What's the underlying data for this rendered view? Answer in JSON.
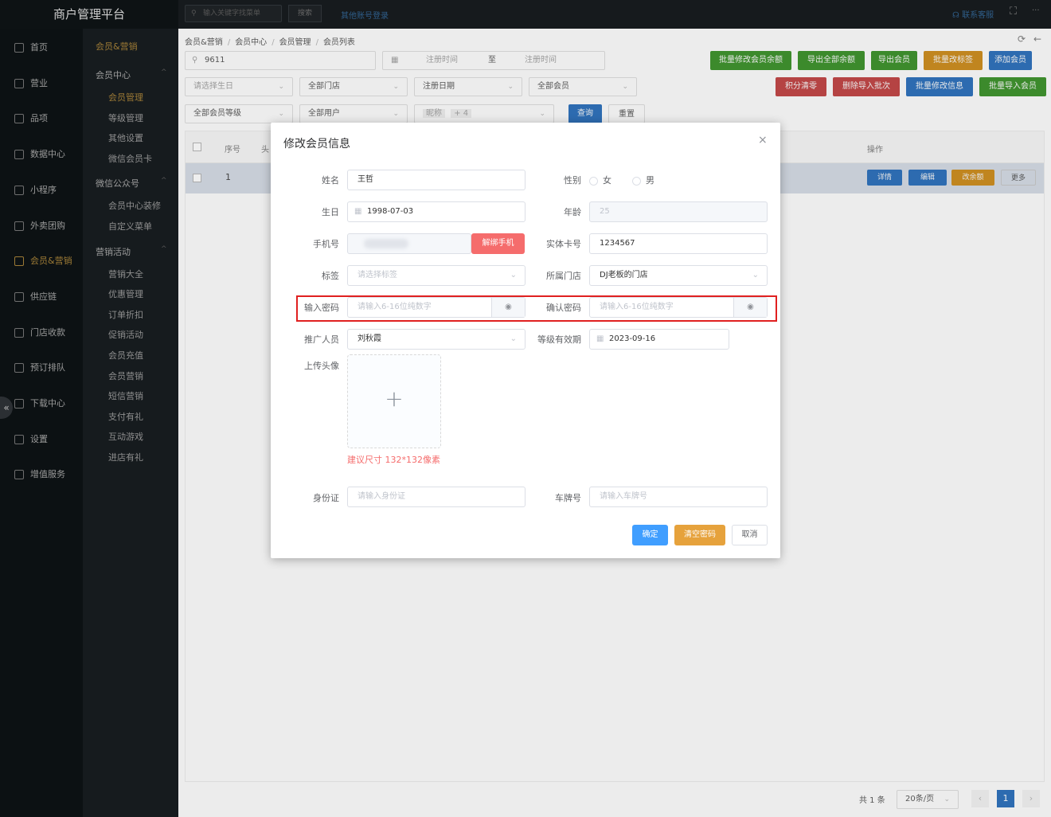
{
  "app": {
    "title": "商户管理平台"
  },
  "topbar": {
    "search_placeholder": "输入关键字找菜单",
    "search_button": "搜索",
    "other_login": "其他账号登录",
    "contact": "联系客服",
    "more": "···"
  },
  "nav": {
    "items": [
      {
        "label": "首页"
      },
      {
        "label": "营业"
      },
      {
        "label": "品项"
      },
      {
        "label": "数据中心"
      },
      {
        "label": "小程序"
      },
      {
        "label": "外卖团购"
      },
      {
        "label": "会员&营销"
      },
      {
        "label": "供应链"
      },
      {
        "label": "门店收款"
      },
      {
        "label": "预订排队"
      },
      {
        "label": "下载中心"
      },
      {
        "label": "设置"
      },
      {
        "label": "增值服务"
      }
    ],
    "collapse": "«"
  },
  "subnav": {
    "header": "会员&营销",
    "groups": [
      {
        "title": "会员中心",
        "items": [
          "会员管理",
          "等级管理",
          "其他设置",
          "微信会员卡"
        ]
      },
      {
        "title": "微信公众号",
        "items": [
          "会员中心装修",
          "自定义菜单"
        ]
      },
      {
        "title": "营销活动",
        "items": [
          "营销大全",
          "优惠管理",
          "订单折扣",
          "促销活动",
          "会员充值",
          "会员营销",
          "短信营销",
          "支付有礼",
          "互动游戏",
          "进店有礼"
        ]
      }
    ]
  },
  "breadcrumb": [
    "会员&营销",
    "/",
    "会员中心",
    "/",
    "会员管理",
    "/",
    "会员列表"
  ],
  "filters": {
    "search_value": "9611",
    "date_start": "注册时间",
    "date_sep": "至",
    "date_end": "注册时间",
    "birthday": "请选择生日",
    "store": "全部门店",
    "reg_date": "注册日期",
    "member": "全部会员",
    "level": "全部会员等级",
    "users": "全部用户",
    "nickname": "昵称",
    "nickname_count": "+ 4",
    "query": "查询",
    "reset": "重置"
  },
  "actions": {
    "row1": [
      "批量修改会员余额",
      "导出全部余额",
      "导出会员",
      "批量改标签",
      "添加会员"
    ],
    "row2": [
      "积分清零",
      "删除导入批次",
      "批量修改信息",
      "批量导入会员"
    ]
  },
  "table": {
    "headers": [
      "序号",
      "头",
      "操作"
    ],
    "rows": [
      {
        "index": "1",
        "ops": [
          "详情",
          "编辑",
          "改余额",
          "更多"
        ]
      }
    ]
  },
  "pager": {
    "total": "共 1 条",
    "size": "20条/页",
    "prev": "‹",
    "page": "1",
    "next": "›"
  },
  "modal": {
    "title": "修改会员信息",
    "close": "×",
    "name_label": "姓名",
    "name_value": "王哲",
    "gender_label": "性别",
    "gender_female": "女",
    "gender_male": "男",
    "birthday_label": "生日",
    "birthday_value": "1998-07-03",
    "age_label": "年龄",
    "age_value": "25",
    "phone_label": "手机号",
    "unbind": "解绑手机",
    "card_label": "实体卡号",
    "card_value": "1234567",
    "tag_label": "标签",
    "tag_placeholder": "请选择标签",
    "store_label": "所属门店",
    "store_value": "DJ老板的门店",
    "pwd_label": "输入密码",
    "pwd_placeholder": "请输入6-16位纯数字",
    "confirm_label": "确认密码",
    "confirm_placeholder": "请输入6-16位纯数字",
    "promoter_label": "推广人员",
    "promoter_value": "刘秋霞",
    "expiry_label": "等级有效期",
    "expiry_value": "2023-09-16",
    "avatar_label": "上传头像",
    "avatar_plus": "+",
    "avatar_hint": "建议尺寸 132*132像素",
    "id_label": "身份证",
    "id_placeholder": "请输入身份证",
    "plate_label": "车牌号",
    "plate_placeholder": "请输入车牌号",
    "ok": "确定",
    "clear_pwd": "清空密码",
    "cancel": "取消"
  },
  "colors": {
    "accent_gold": "#9c7a35",
    "primary": "#409eff",
    "warning": "#e6a23c",
    "danger": "#f56c6c",
    "highlight": "#e02020"
  }
}
